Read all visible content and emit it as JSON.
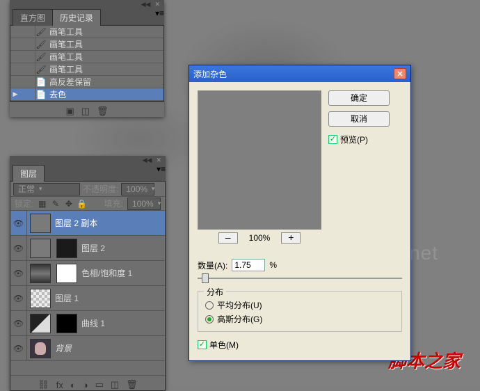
{
  "watermarks": {
    "url": "www.jb51.net",
    "brand": "脚本之家"
  },
  "history": {
    "tabs": [
      "直方图",
      "历史记录"
    ],
    "active_tab": 1,
    "items": [
      {
        "icon": "brush",
        "label": "画笔工具"
      },
      {
        "icon": "brush",
        "label": "画笔工具"
      },
      {
        "icon": "brush",
        "label": "画笔工具"
      },
      {
        "icon": "brush",
        "label": "画笔工具"
      },
      {
        "icon": "file",
        "label": "高反差保留"
      },
      {
        "icon": "file",
        "label": "去色",
        "selected": true,
        "pointer": true
      }
    ]
  },
  "layers": {
    "tab": "图层",
    "blend_mode": "正常",
    "opacity_label": "不透明度:",
    "opacity_value": "100%",
    "lock_label": "锁定:",
    "fill_label": "填充:",
    "fill_value": "100%",
    "items": [
      {
        "label": "图层 2 副本",
        "thumbs": [
          "gray"
        ],
        "selected": true
      },
      {
        "label": "图层 2",
        "thumbs": [
          "gray",
          "dark"
        ]
      },
      {
        "label": "色相/饱和度 1",
        "thumbs": [
          "hue",
          "mask"
        ]
      },
      {
        "label": "图层 1",
        "thumbs": [
          "trans"
        ]
      },
      {
        "label": "曲线 1",
        "thumbs": [
          "curve",
          "mask blk"
        ]
      },
      {
        "label": "背景",
        "thumbs": [
          "face"
        ],
        "italic": true
      }
    ]
  },
  "dialog": {
    "title": "添加杂色",
    "ok": "确定",
    "cancel": "取消",
    "preview": "预览(P)",
    "zoom": "100%",
    "amount_label": "数量(A):",
    "amount_value": "1.75",
    "amount_unit": "%",
    "distribution_label": "分布",
    "uniform": "平均分布(U)",
    "gaussian": "高斯分布(G)",
    "mono": "单色(M)"
  }
}
